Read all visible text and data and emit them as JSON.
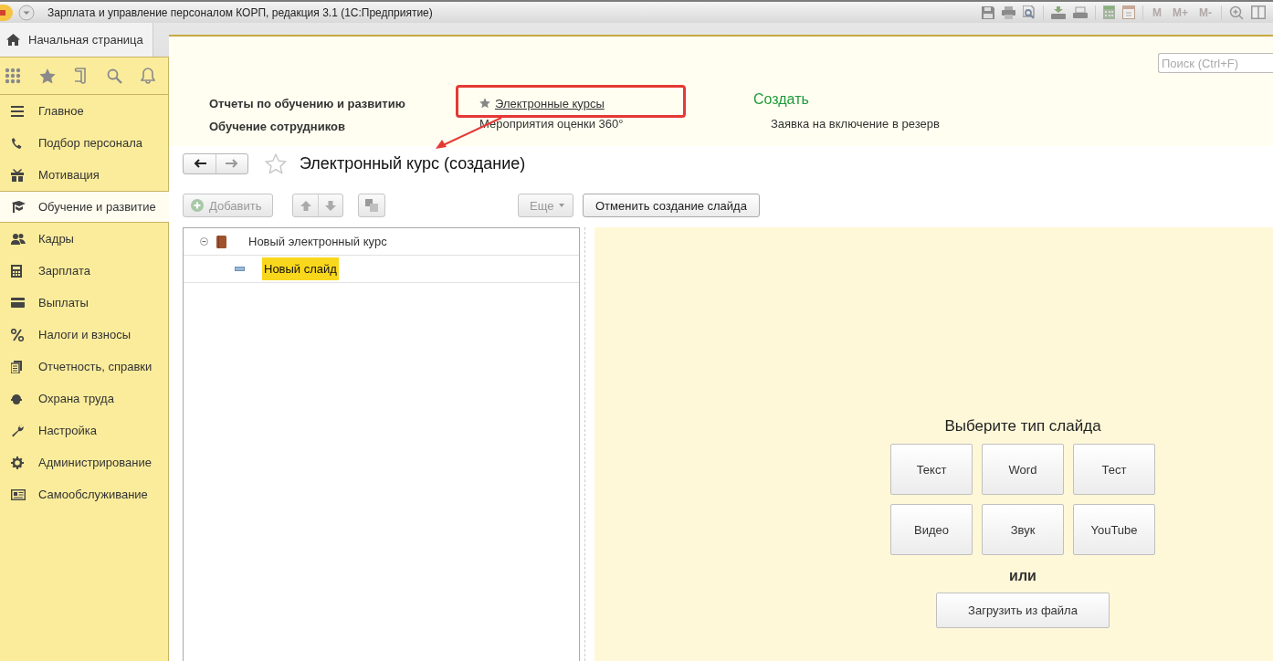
{
  "window": {
    "title": "Зарплата и управление персоналом КОРП, редакция 3.1  (1С:Предприятие)",
    "memory_buttons": [
      "M",
      "M+",
      "M-"
    ]
  },
  "home_tab": {
    "label": "Начальная страница"
  },
  "sidebar": {
    "items": [
      {
        "label": "Главное",
        "selected": false
      },
      {
        "label": "Подбор персонала",
        "selected": false
      },
      {
        "label": "Мотивация",
        "selected": false
      },
      {
        "label": "Обучение и развитие",
        "selected": true
      },
      {
        "label": "Кадры",
        "selected": false
      },
      {
        "label": "Зарплата",
        "selected": false
      },
      {
        "label": "Выплаты",
        "selected": false
      },
      {
        "label": "Налоги и взносы",
        "selected": false
      },
      {
        "label": "Отчетность, справки",
        "selected": false
      },
      {
        "label": "Охрана труда",
        "selected": false
      },
      {
        "label": "Настройка",
        "selected": false
      },
      {
        "label": "Администрирование",
        "selected": false
      },
      {
        "label": "Самообслуживание",
        "selected": false
      }
    ]
  },
  "nav_panel": {
    "search": {
      "placeholder": "Поиск (Ctrl+F)"
    },
    "groups": [
      "Отчеты по обучению и развитию",
      "Обучение сотрудников"
    ],
    "links": [
      {
        "label": "Электронные курсы",
        "starred": true,
        "highlighted": true
      },
      {
        "label": "Мероприятия оценки 360°",
        "starred": false,
        "highlighted": false
      }
    ],
    "create": {
      "title": "Создать",
      "items": [
        "Заявка на включение в резерв"
      ]
    }
  },
  "form": {
    "title": "Электронный курс (создание)",
    "toolbar": {
      "add": "Добавить",
      "more": "Еще"
    },
    "cancel_button": "Отменить создание слайда",
    "tree": [
      {
        "label": "Новый электронный курс",
        "expanded": true,
        "selected": false,
        "children": [
          {
            "label": "Новый слайд",
            "selected": true
          }
        ]
      }
    ],
    "slide_type": {
      "title": "Выберите тип слайда",
      "types": [
        "Текст",
        "Word",
        "Тест",
        "Видео",
        "Звук",
        "YouTube"
      ],
      "or": "или",
      "upload": "Загрузить из файла"
    }
  }
}
